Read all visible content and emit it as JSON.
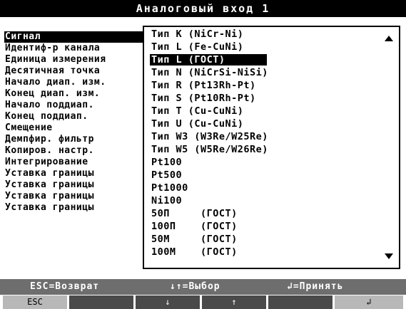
{
  "title": "Аналоговый вход  1",
  "menu": [
    "Сигнал",
    "Идентиф-р канала",
    "Единица измерения",
    "Десятичная точка",
    "Начало диап. изм.",
    "Конец  диап. изм.",
    "Начало поддиап.",
    "Конец  поддиап.",
    "Смещение",
    "Демпфир. фильтр",
    "Копиров. настр.",
    "Интегрирование",
    "Уставка границы",
    "Уставка границы",
    "Уставка границы",
    "Уставка границы"
  ],
  "dropdown": {
    "selected_index": 2,
    "options": [
      "Тип K  (NiCr-Ni)",
      "Тип L  (Fe-CuNi)",
      "Тип L  (ГОСТ)",
      "Тип N  (NiCrSi-NiSi)",
      "Тип R  (Pt13Rh-Pt)",
      "Тип S  (Pt10Rh-Pt)",
      "Тип T  (Cu-CuNi)",
      "Тип U  (Cu-CuNi)",
      "Тип W3  (W3Re/W25Re)",
      "Тип W5  (W5Re/W26Re)",
      "Pt100",
      "Pt500",
      "Pt1000",
      "Ni100",
      "50П     (ГОСТ)",
      "100П    (ГОСТ)",
      "50М     (ГОСТ)",
      "100М    (ГОСТ)"
    ]
  },
  "status": {
    "esc": "ESC=Возврат",
    "select": "↓↑=Выбор",
    "accept": "↲=Принять"
  },
  "softkeys": [
    "ESC",
    "",
    "↓",
    "↑",
    "",
    "↲"
  ]
}
